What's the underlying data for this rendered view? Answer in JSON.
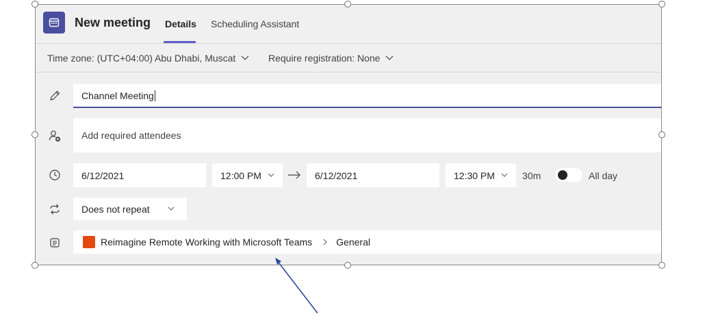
{
  "header": {
    "title": "New meeting",
    "tabs": [
      {
        "label": "Details",
        "active": true
      },
      {
        "label": "Scheduling Assistant",
        "active": false
      }
    ]
  },
  "toolbar": {
    "timezone_label": "Time zone: (UTC+04:00) Abu Dhabi, Muscat",
    "registration_label": "Require registration: None"
  },
  "form": {
    "title_value": "Channel Meeting",
    "attendees_placeholder": "Add required attendees",
    "start_date": "6/12/2021",
    "start_time": "12:00 PM",
    "end_date": "6/12/2021",
    "end_time": "12:30 PM",
    "duration": "30m",
    "all_day_label": "All day",
    "all_day": false,
    "repeat_value": "Does not repeat",
    "channel_team": "Reimagine Remote Working with Microsoft Teams",
    "channel_name": "General"
  },
  "colors": {
    "accent": "#5b5fc7",
    "app_icon_bg": "#4b4e9e",
    "team_badge": "#e34a0f",
    "arrow": "#2a4a9a"
  }
}
